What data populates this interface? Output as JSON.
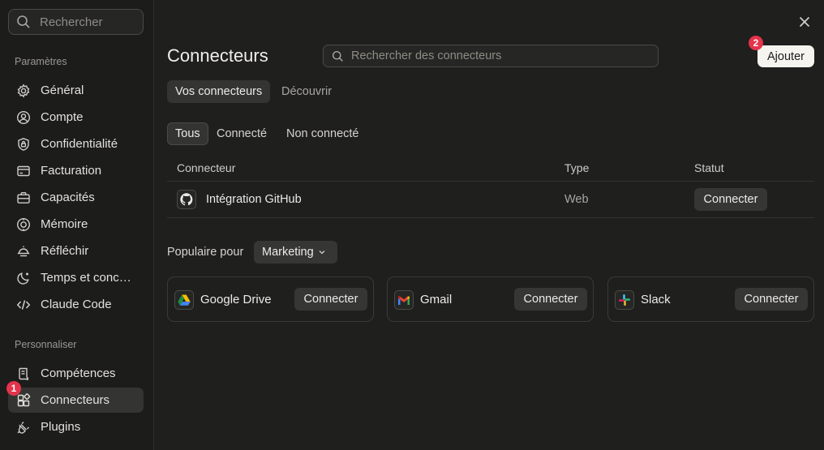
{
  "sidebar": {
    "search_placeholder": "Rechercher",
    "section_settings": "Paramètres",
    "section_customize": "Personnaliser",
    "items": [
      {
        "label": "Général",
        "icon": "gear-icon"
      },
      {
        "label": "Compte",
        "icon": "user-circle-icon"
      },
      {
        "label": "Confidentialité",
        "icon": "shield-icon"
      },
      {
        "label": "Facturation",
        "icon": "credit-card-icon"
      },
      {
        "label": "Capacités",
        "icon": "briefcase-icon"
      },
      {
        "label": "Mémoire",
        "icon": "memory-icon"
      },
      {
        "label": "Réfléchir",
        "icon": "sunrise-icon"
      },
      {
        "label": "Temps et concentration",
        "icon": "moon-icon"
      },
      {
        "label": "Claude Code",
        "icon": "code-icon"
      }
    ],
    "custom_items": [
      {
        "label": "Compétences",
        "icon": "scroll-icon"
      },
      {
        "label": "Connecteurs",
        "icon": "connectors-icon",
        "active": true
      },
      {
        "label": "Plugins",
        "icon": "plug-icon"
      }
    ],
    "badge_connectors": "1"
  },
  "header": {
    "title": "Connecteurs",
    "search_placeholder": "Rechercher des connecteurs",
    "add_label": "Ajouter",
    "add_badge": "2"
  },
  "tabs": [
    {
      "label": "Vos connecteurs",
      "active": true
    },
    {
      "label": "Découvrir",
      "active": false
    }
  ],
  "filters": [
    {
      "label": "Tous",
      "active": true
    },
    {
      "label": "Connecté",
      "active": false
    },
    {
      "label": "Non connecté",
      "active": false
    }
  ],
  "table": {
    "columns": [
      "Connecteur",
      "Type",
      "Statut"
    ],
    "rows": [
      {
        "name": "Intégration GitHub",
        "type": "Web",
        "action": "Connecter",
        "icon": "github-icon"
      }
    ]
  },
  "popular": {
    "label": "Populaire pour",
    "selected": "Marketing",
    "cards": [
      {
        "name": "Google Drive",
        "action": "Connecter",
        "icon": "google-drive-icon"
      },
      {
        "name": "Gmail",
        "action": "Connecter",
        "icon": "gmail-icon"
      },
      {
        "name": "Slack",
        "action": "Connecter",
        "icon": "slack-icon"
      }
    ]
  },
  "colors": {
    "background": "#1f1f1e",
    "sidebar": "#1c1c1b",
    "accent_badge": "#e5334b",
    "primary_button": "#f5f4ef"
  }
}
